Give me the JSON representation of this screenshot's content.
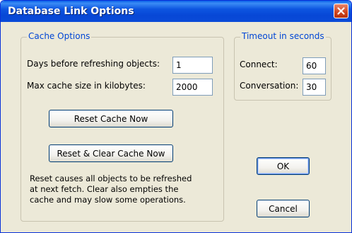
{
  "window": {
    "title": "Database Link Options"
  },
  "cache": {
    "group_label": "Cache Options",
    "days_label": "Days before refreshing objects:",
    "days_value": "1",
    "size_label": "Max cache size in kilobytes:",
    "size_value": "2000",
    "reset_button": "Reset Cache Now",
    "reset_clear_button": "Reset & Clear Cache Now",
    "help_lines": [
      "Reset causes all objects to be refreshed",
      "at next fetch.  Clear also empties the",
      "cache and may slow some operations."
    ]
  },
  "timeout": {
    "group_label": "Timeout in seconds",
    "connect_label": "Connect:",
    "connect_value": "60",
    "conversation_label": "Conversation:",
    "conversation_value": "30"
  },
  "buttons": {
    "ok": "OK",
    "cancel": "Cancel"
  },
  "icons": {
    "close": "close-icon"
  },
  "colors": {
    "titlebar": "#0a4bd8",
    "legend": "#0046d5",
    "face": "#ece9d8",
    "close": "#d0431c"
  }
}
